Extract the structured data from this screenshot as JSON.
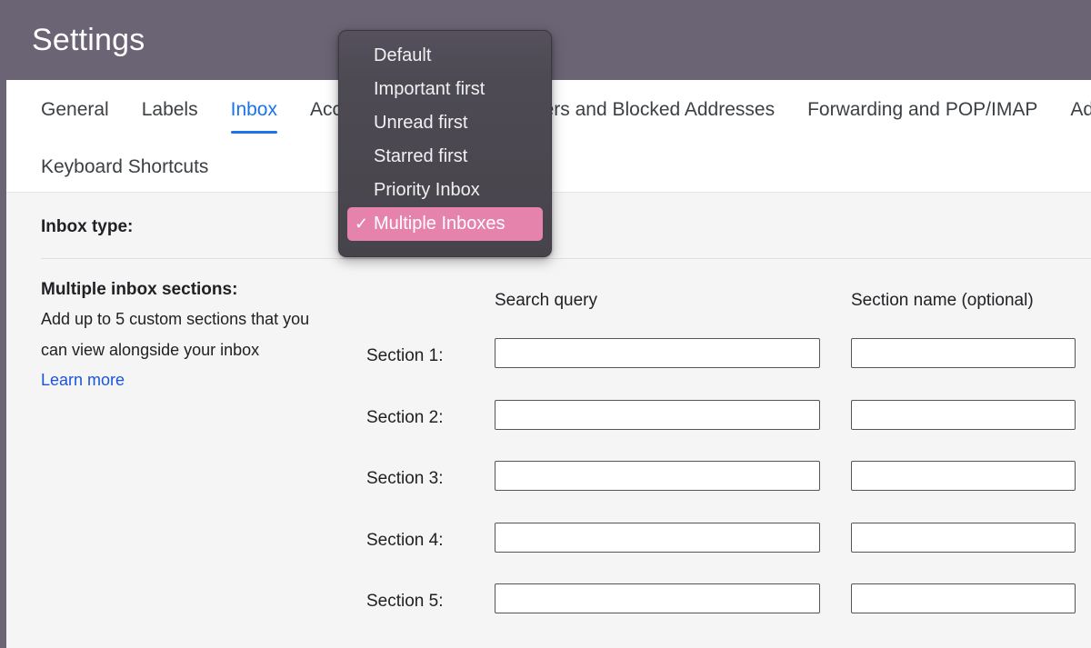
{
  "header": {
    "title": "Settings",
    "bg_color": "#6b6475"
  },
  "tabs": {
    "row1": [
      {
        "label": "General",
        "active": false
      },
      {
        "label": "Labels",
        "active": false
      },
      {
        "label": "Inbox",
        "active": true
      },
      {
        "label": "Accounts and Import",
        "active": false
      },
      {
        "label": "Filters and Blocked Addresses",
        "active": false
      },
      {
        "label": "Forwarding and POP/IMAP",
        "active": false
      },
      {
        "label": "Add-ons",
        "active": false
      }
    ],
    "row2": [
      {
        "label": "Keyboard Shortcuts",
        "active": false
      }
    ],
    "active_color": "#1a73e8"
  },
  "settings": {
    "inbox_type_label": "Inbox type:",
    "multiple_sections_title": "Multiple inbox sections:",
    "multiple_sections_desc_line1": "Add up to 5 custom sections that you",
    "multiple_sections_desc_line2": "can view alongside your inbox",
    "learn_more_label": "Learn more",
    "learn_more_color": "#1a56d6"
  },
  "form": {
    "col_head_query": "Search query",
    "col_head_name": "Section name (optional)",
    "rows": [
      {
        "label": "Section 1:",
        "query_value": "",
        "name_value": ""
      },
      {
        "label": "Section 2:",
        "query_value": "",
        "name_value": ""
      },
      {
        "label": "Section 3:",
        "query_value": "",
        "name_value": ""
      },
      {
        "label": "Section 4:",
        "query_value": "",
        "name_value": ""
      },
      {
        "label": "Section 5:",
        "query_value": "",
        "name_value": ""
      }
    ]
  },
  "dropdown": {
    "open": true,
    "selected": "Multiple Inboxes",
    "check_glyph": "✓",
    "highlight_color": "#e583ad",
    "bg_color": "#4d4a54",
    "items": [
      {
        "label": "Default",
        "selected": false
      },
      {
        "label": "Important first",
        "selected": false
      },
      {
        "label": "Unread first",
        "selected": false
      },
      {
        "label": "Starred first",
        "selected": false
      },
      {
        "label": "Priority Inbox",
        "selected": false
      },
      {
        "label": "Multiple Inboxes",
        "selected": true
      }
    ]
  }
}
